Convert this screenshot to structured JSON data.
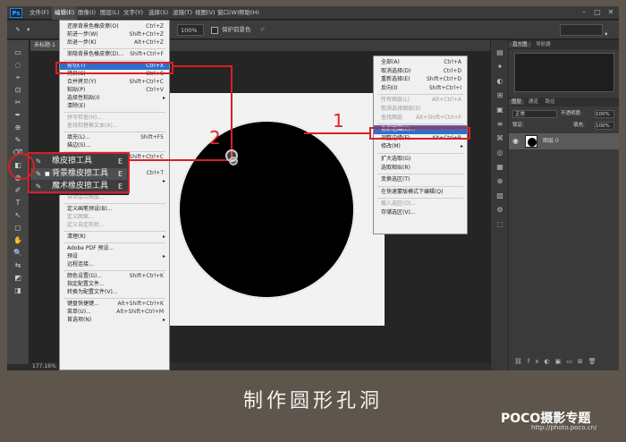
{
  "app": {
    "logo": "Ps"
  },
  "menubar": [
    "文件(F)",
    "编辑(E)",
    "图像(I)",
    "图层(L)",
    "文字(Y)",
    "选择(S)",
    "滤镜(T)",
    "视图(V)",
    "窗口(W)",
    "帮助(H)"
  ],
  "window_controls": [
    "–",
    "□",
    "✕"
  ],
  "options": {
    "zoom": "100%",
    "protect_foreground": "保护前景色"
  },
  "document_tab": "未标题-1",
  "status": {
    "zoom": "177.16%"
  },
  "edit_menu": [
    {
      "label": "还原背景色橡皮擦(O)",
      "shortcut": "Ctrl+Z"
    },
    {
      "label": "前进一步(W)",
      "shortcut": "Shift+Ctrl+Z"
    },
    {
      "label": "后退一步(K)",
      "shortcut": "Alt+Ctrl+Z"
    },
    {
      "sep": true
    },
    {
      "label": "渐隐背景色橡皮擦(D)...",
      "shortcut": "Shift+Ctrl+F"
    },
    {
      "sep": true
    },
    {
      "label": "剪切(T)",
      "shortcut": "Ctrl+X",
      "hl": true
    },
    {
      "label": "拷贝(C)",
      "shortcut": "Ctrl+C"
    },
    {
      "label": "合并拷贝(Y)",
      "shortcut": "Shift+Ctrl+C"
    },
    {
      "label": "粘贴(P)",
      "shortcut": "Ctrl+V"
    },
    {
      "label": "选择性粘贴(I)",
      "arrow": true
    },
    {
      "label": "清除(E)"
    },
    {
      "sep": true
    },
    {
      "label": "拼写检查(H)...",
      "dis": true
    },
    {
      "label": "查找和替换文本(X)...",
      "dis": true
    },
    {
      "sep": true
    },
    {
      "label": "填充(L)...",
      "shortcut": "Shift+F5"
    },
    {
      "label": "描边(S)..."
    },
    {
      "sep": true
    },
    {
      "label": "内容识别比例",
      "shortcut": "Alt+Shift+Ctrl+C"
    },
    {
      "label": "操控变形"
    },
    {
      "label": "自由变换(F)",
      "shortcut": "Ctrl+T"
    },
    {
      "label": "变换",
      "arrow": true
    },
    {
      "label": "自动对齐图层...",
      "dis": true
    },
    {
      "label": "自动混合图层...",
      "dis": true
    },
    {
      "sep": true
    },
    {
      "label": "定义画笔预设(B)..."
    },
    {
      "label": "定义图案...",
      "dis": true
    },
    {
      "label": "定义自定形状...",
      "dis": true
    },
    {
      "sep": true
    },
    {
      "label": "清理(R)",
      "arrow": true
    },
    {
      "sep": true
    },
    {
      "label": "Adobe PDF 预设..."
    },
    {
      "label": "预设",
      "arrow": true
    },
    {
      "label": "远程连接..."
    },
    {
      "sep": true
    },
    {
      "label": "颜色设置(G)...",
      "shortcut": "Shift+Ctrl+K"
    },
    {
      "label": "指定配置文件..."
    },
    {
      "label": "转换为配置文件(V)..."
    },
    {
      "sep": true
    },
    {
      "label": "键盘快捷键...",
      "shortcut": "Alt+Shift+Ctrl+K"
    },
    {
      "label": "菜单(U)...",
      "shortcut": "Alt+Shift+Ctrl+M"
    },
    {
      "label": "首选项(N)",
      "arrow": true
    }
  ],
  "context_menu": [
    {
      "label": "全部(A)",
      "shortcut": "Ctrl+A"
    },
    {
      "label": "取消选择(D)",
      "shortcut": "Ctrl+D"
    },
    {
      "label": "重新选择(E)",
      "shortcut": "Shift+Ctrl+D"
    },
    {
      "label": "反向(I)",
      "shortcut": "Shift+Ctrl+I"
    },
    {
      "sep": true
    },
    {
      "label": "所有图层(L)",
      "shortcut": "Alt+Ctrl+A",
      "dis": true
    },
    {
      "label": "取消选择图层(S)",
      "dis": true
    },
    {
      "label": "查找图层",
      "shortcut": "Alt+Shift+Ctrl+F",
      "dis": true
    },
    {
      "sep": true
    },
    {
      "label": "色彩范围(C)...",
      "hl": true
    },
    {
      "label": "调整边缘(F)...",
      "shortcut": "Alt+Ctrl+R"
    },
    {
      "label": "修改(M)",
      "arrow": true
    },
    {
      "sep": true
    },
    {
      "label": "扩大选取(G)"
    },
    {
      "label": "选取相似(R)"
    },
    {
      "sep": true
    },
    {
      "label": "变换选区(T)"
    },
    {
      "sep": true
    },
    {
      "label": "在快速蒙版模式下编辑(Q)"
    },
    {
      "sep": true
    },
    {
      "label": "载入选区(O)...",
      "dis": true
    },
    {
      "label": "存储选区(V)..."
    }
  ],
  "eraser_flyout": [
    {
      "icon": "✎",
      "label": "橡皮擦工具",
      "key": "E"
    },
    {
      "icon": "✎",
      "label": "背景橡皮擦工具",
      "key": "E",
      "active": true
    },
    {
      "icon": "✎",
      "label": "魔术橡皮擦工具",
      "key": "E"
    }
  ],
  "annotations": {
    "one": "1",
    "two": "2"
  },
  "panels": {
    "top_tabs": [
      "直方图",
      "导航器"
    ],
    "layer_tabs": [
      "图层",
      "通道",
      "路径"
    ],
    "blend_mode": "正常",
    "opacity_label": "不透明度:",
    "opacity": "100%",
    "lock_label": "锁定:",
    "fill_label": "填充:",
    "fill": "100%",
    "layer_name": "图层 0"
  },
  "caption": "制作圆形孔洞",
  "brand": {
    "name": "POCO摄影专题",
    "url": "http://photo.poco.cn/"
  }
}
